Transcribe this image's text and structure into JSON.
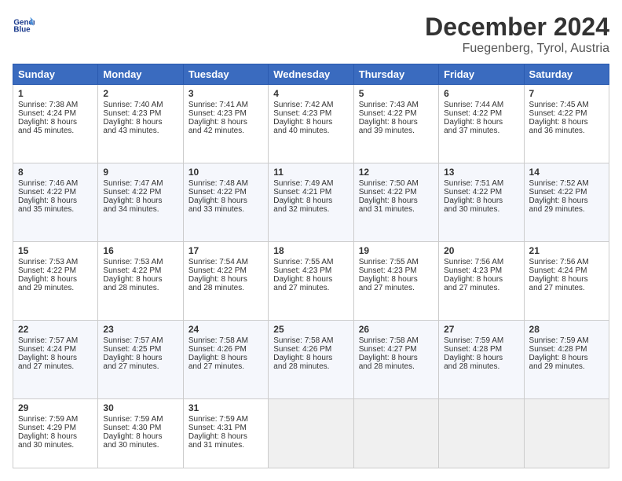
{
  "header": {
    "logo_line1": "General",
    "logo_line2": "Blue",
    "title": "December 2024",
    "subtitle": "Fuegenberg, Tyrol, Austria"
  },
  "calendar": {
    "days_of_week": [
      "Sunday",
      "Monday",
      "Tuesday",
      "Wednesday",
      "Thursday",
      "Friday",
      "Saturday"
    ],
    "weeks": [
      [
        {
          "day": "1",
          "lines": [
            "Sunrise: 7:38 AM",
            "Sunset: 4:24 PM",
            "Daylight: 8 hours",
            "and 45 minutes."
          ]
        },
        {
          "day": "2",
          "lines": [
            "Sunrise: 7:40 AM",
            "Sunset: 4:23 PM",
            "Daylight: 8 hours",
            "and 43 minutes."
          ]
        },
        {
          "day": "3",
          "lines": [
            "Sunrise: 7:41 AM",
            "Sunset: 4:23 PM",
            "Daylight: 8 hours",
            "and 42 minutes."
          ]
        },
        {
          "day": "4",
          "lines": [
            "Sunrise: 7:42 AM",
            "Sunset: 4:23 PM",
            "Daylight: 8 hours",
            "and 40 minutes."
          ]
        },
        {
          "day": "5",
          "lines": [
            "Sunrise: 7:43 AM",
            "Sunset: 4:22 PM",
            "Daylight: 8 hours",
            "and 39 minutes."
          ]
        },
        {
          "day": "6",
          "lines": [
            "Sunrise: 7:44 AM",
            "Sunset: 4:22 PM",
            "Daylight: 8 hours",
            "and 37 minutes."
          ]
        },
        {
          "day": "7",
          "lines": [
            "Sunrise: 7:45 AM",
            "Sunset: 4:22 PM",
            "Daylight: 8 hours",
            "and 36 minutes."
          ]
        }
      ],
      [
        {
          "day": "8",
          "lines": [
            "Sunrise: 7:46 AM",
            "Sunset: 4:22 PM",
            "Daylight: 8 hours",
            "and 35 minutes."
          ]
        },
        {
          "day": "9",
          "lines": [
            "Sunrise: 7:47 AM",
            "Sunset: 4:22 PM",
            "Daylight: 8 hours",
            "and 34 minutes."
          ]
        },
        {
          "day": "10",
          "lines": [
            "Sunrise: 7:48 AM",
            "Sunset: 4:22 PM",
            "Daylight: 8 hours",
            "and 33 minutes."
          ]
        },
        {
          "day": "11",
          "lines": [
            "Sunrise: 7:49 AM",
            "Sunset: 4:21 PM",
            "Daylight: 8 hours",
            "and 32 minutes."
          ]
        },
        {
          "day": "12",
          "lines": [
            "Sunrise: 7:50 AM",
            "Sunset: 4:22 PM",
            "Daylight: 8 hours",
            "and 31 minutes."
          ]
        },
        {
          "day": "13",
          "lines": [
            "Sunrise: 7:51 AM",
            "Sunset: 4:22 PM",
            "Daylight: 8 hours",
            "and 30 minutes."
          ]
        },
        {
          "day": "14",
          "lines": [
            "Sunrise: 7:52 AM",
            "Sunset: 4:22 PM",
            "Daylight: 8 hours",
            "and 29 minutes."
          ]
        }
      ],
      [
        {
          "day": "15",
          "lines": [
            "Sunrise: 7:53 AM",
            "Sunset: 4:22 PM",
            "Daylight: 8 hours",
            "and 29 minutes."
          ]
        },
        {
          "day": "16",
          "lines": [
            "Sunrise: 7:53 AM",
            "Sunset: 4:22 PM",
            "Daylight: 8 hours",
            "and 28 minutes."
          ]
        },
        {
          "day": "17",
          "lines": [
            "Sunrise: 7:54 AM",
            "Sunset: 4:22 PM",
            "Daylight: 8 hours",
            "and 28 minutes."
          ]
        },
        {
          "day": "18",
          "lines": [
            "Sunrise: 7:55 AM",
            "Sunset: 4:23 PM",
            "Daylight: 8 hours",
            "and 27 minutes."
          ]
        },
        {
          "day": "19",
          "lines": [
            "Sunrise: 7:55 AM",
            "Sunset: 4:23 PM",
            "Daylight: 8 hours",
            "and 27 minutes."
          ]
        },
        {
          "day": "20",
          "lines": [
            "Sunrise: 7:56 AM",
            "Sunset: 4:23 PM",
            "Daylight: 8 hours",
            "and 27 minutes."
          ]
        },
        {
          "day": "21",
          "lines": [
            "Sunrise: 7:56 AM",
            "Sunset: 4:24 PM",
            "Daylight: 8 hours",
            "and 27 minutes."
          ]
        }
      ],
      [
        {
          "day": "22",
          "lines": [
            "Sunrise: 7:57 AM",
            "Sunset: 4:24 PM",
            "Daylight: 8 hours",
            "and 27 minutes."
          ]
        },
        {
          "day": "23",
          "lines": [
            "Sunrise: 7:57 AM",
            "Sunset: 4:25 PM",
            "Daylight: 8 hours",
            "and 27 minutes."
          ]
        },
        {
          "day": "24",
          "lines": [
            "Sunrise: 7:58 AM",
            "Sunset: 4:26 PM",
            "Daylight: 8 hours",
            "and 27 minutes."
          ]
        },
        {
          "day": "25",
          "lines": [
            "Sunrise: 7:58 AM",
            "Sunset: 4:26 PM",
            "Daylight: 8 hours",
            "and 28 minutes."
          ]
        },
        {
          "day": "26",
          "lines": [
            "Sunrise: 7:58 AM",
            "Sunset: 4:27 PM",
            "Daylight: 8 hours",
            "and 28 minutes."
          ]
        },
        {
          "day": "27",
          "lines": [
            "Sunrise: 7:59 AM",
            "Sunset: 4:28 PM",
            "Daylight: 8 hours",
            "and 28 minutes."
          ]
        },
        {
          "day": "28",
          "lines": [
            "Sunrise: 7:59 AM",
            "Sunset: 4:28 PM",
            "Daylight: 8 hours",
            "and 29 minutes."
          ]
        }
      ],
      [
        {
          "day": "29",
          "lines": [
            "Sunrise: 7:59 AM",
            "Sunset: 4:29 PM",
            "Daylight: 8 hours",
            "and 30 minutes."
          ]
        },
        {
          "day": "30",
          "lines": [
            "Sunrise: 7:59 AM",
            "Sunset: 4:30 PM",
            "Daylight: 8 hours",
            "and 30 minutes."
          ]
        },
        {
          "day": "31",
          "lines": [
            "Sunrise: 7:59 AM",
            "Sunset: 4:31 PM",
            "Daylight: 8 hours",
            "and 31 minutes."
          ]
        },
        null,
        null,
        null,
        null
      ]
    ]
  }
}
